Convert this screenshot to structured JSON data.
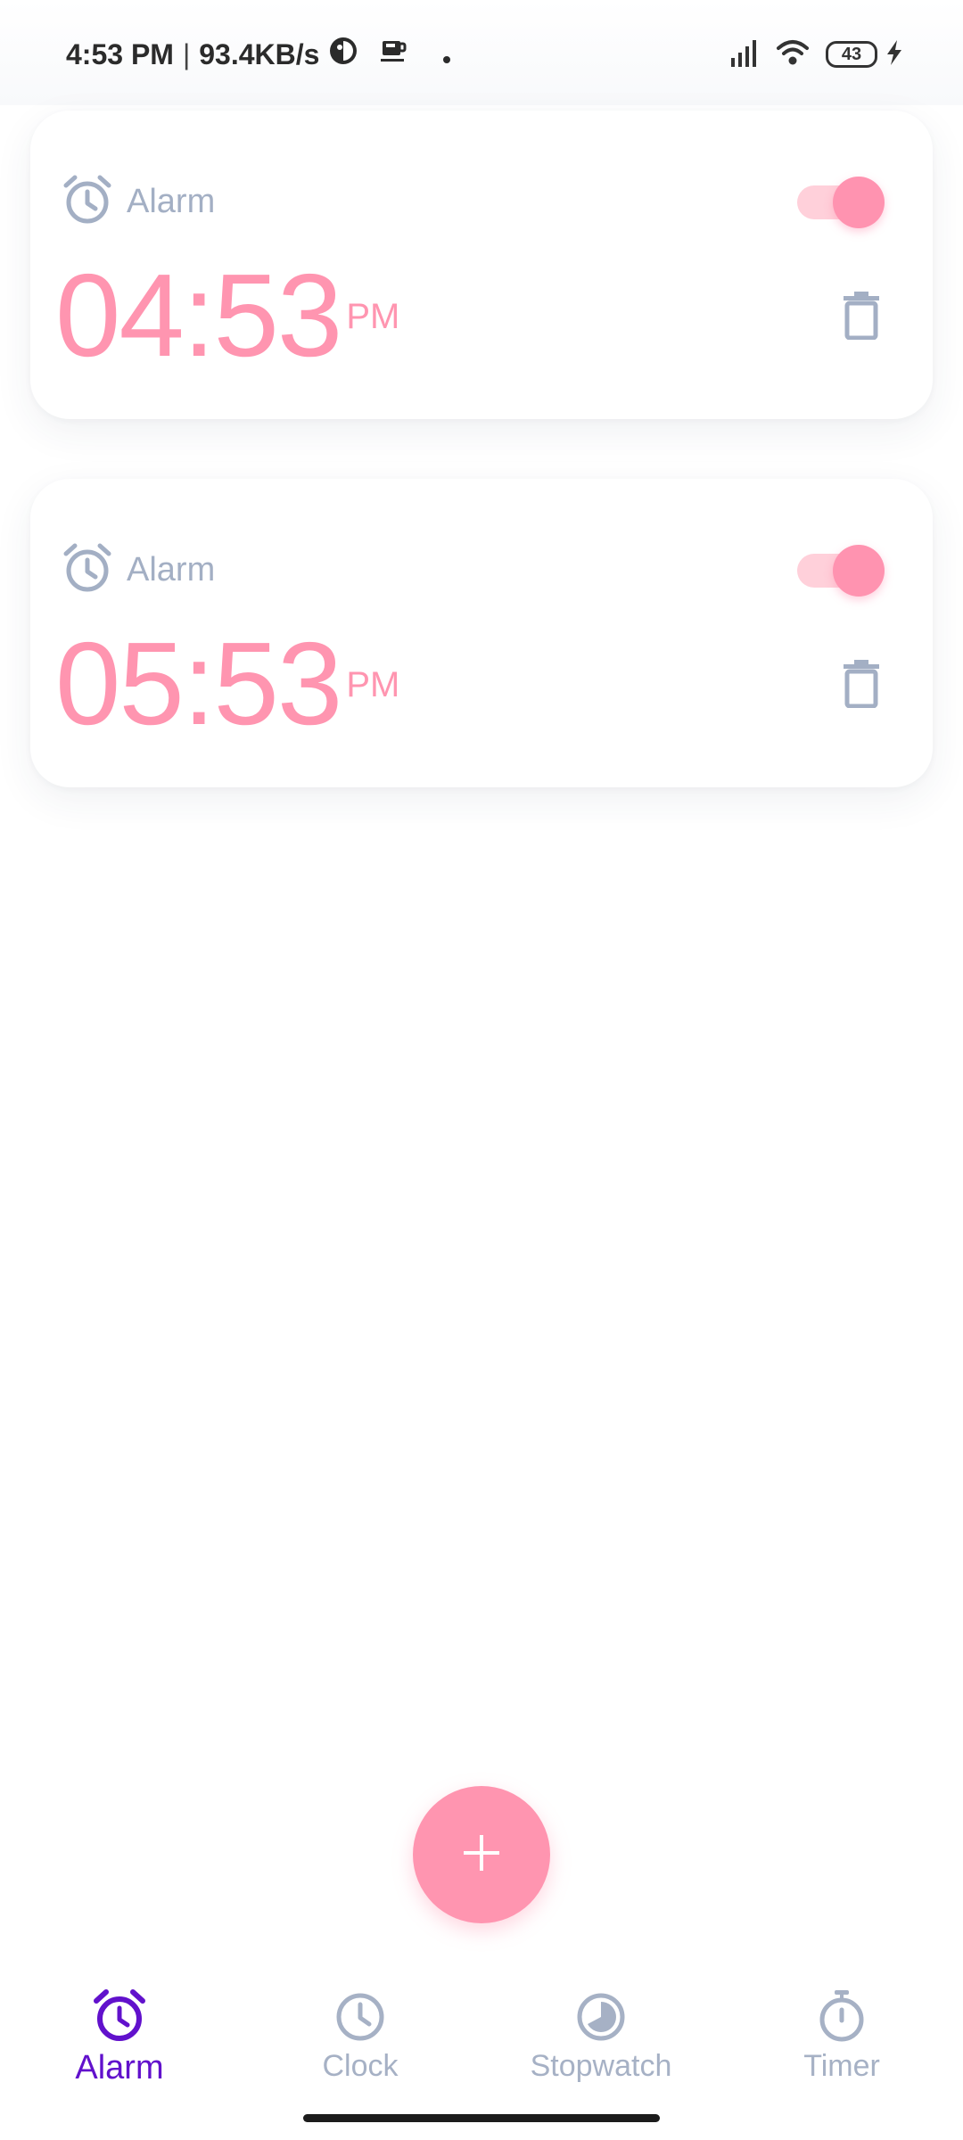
{
  "status_bar": {
    "time": "4:53 PM",
    "separator": "|",
    "network_speed": "93.4KB/s",
    "battery_level": "43",
    "icons": [
      "app-notification-icon",
      "coffee-icon",
      "dot-icon",
      "signal-icon",
      "wifi-icon",
      "battery-icon",
      "charging-icon"
    ]
  },
  "alarms": [
    {
      "label": "Alarm",
      "time": "04:53",
      "ampm": "PM",
      "enabled": true
    },
    {
      "label": "Alarm",
      "time": "05:53",
      "ampm": "PM",
      "enabled": true
    }
  ],
  "colors": {
    "accent_pink": "#ff95b0",
    "toggle_track": "#ffd0da",
    "icon_gray": "#a3afc4",
    "nav_active": "#6111cc",
    "nav_inactive": "#a6b1c5"
  },
  "fab": {
    "icon": "plus-icon"
  },
  "bottom_nav": {
    "items": [
      {
        "label": "Alarm",
        "icon": "alarm-clock-icon",
        "active": true
      },
      {
        "label": "Clock",
        "icon": "clock-icon",
        "active": false
      },
      {
        "label": "Stopwatch",
        "icon": "stopwatch-icon",
        "active": false
      },
      {
        "label": "Timer",
        "icon": "timer-icon",
        "active": false
      }
    ]
  }
}
